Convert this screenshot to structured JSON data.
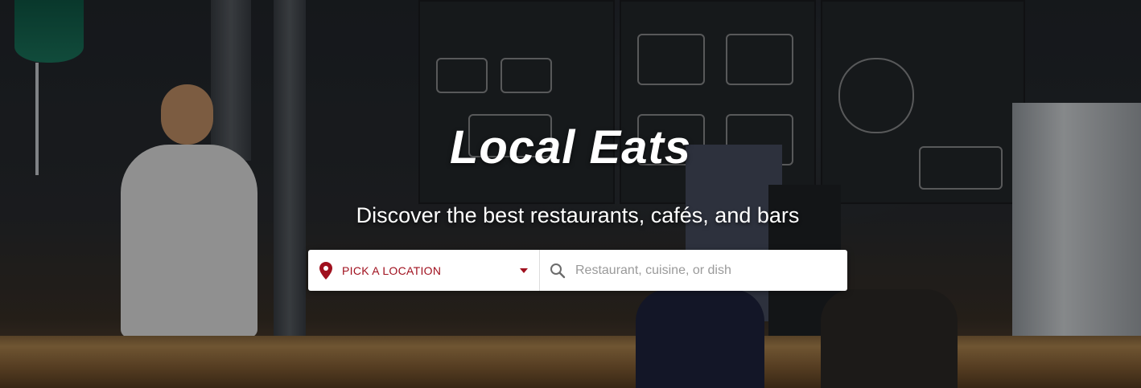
{
  "hero": {
    "title": "Local Eats",
    "subtitle": "Discover the best restaurants, cafés, and bars"
  },
  "search": {
    "location_label": "PICK A LOCATION",
    "location_icon": "map-pin-icon",
    "dropdown_icon": "caret-down-icon",
    "search_icon": "search-icon",
    "query_placeholder": "Restaurant, cuisine, or dish",
    "query_value": ""
  },
  "colors": {
    "accent": "#a0101e",
    "text_on_hero": "#ffffff",
    "search_bg": "#ffffff",
    "placeholder": "#9a9a9a"
  }
}
